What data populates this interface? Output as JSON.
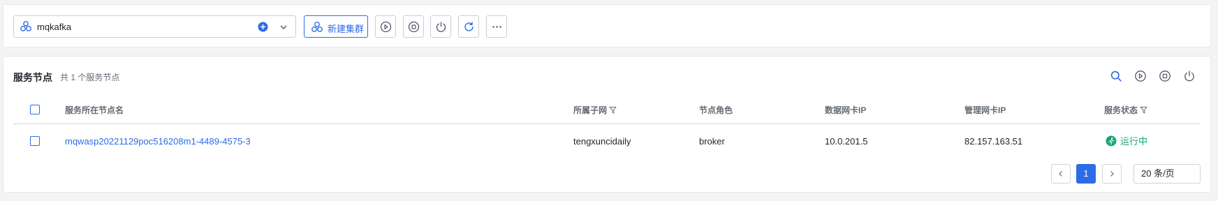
{
  "toolbar": {
    "cluster_select_value": "mqkafka",
    "new_cluster_label": "新建集群",
    "icons": [
      "cluster-icon",
      "add-circle-icon",
      "chevron-down-icon",
      "cluster-add-icon",
      "play-icon",
      "stop-icon",
      "power-icon",
      "refresh-icon",
      "more-icon"
    ]
  },
  "nodes": {
    "title": "服务节点",
    "count_text": "共 1 个服务节点",
    "tools": [
      "search-icon",
      "play-icon",
      "stop-icon",
      "power-icon"
    ],
    "columns": {
      "name": "服务所在节点名",
      "subnet": "所属子网",
      "role": "节点角色",
      "data_ip": "数据网卡IP",
      "mgmt_ip": "管理网卡IP",
      "status": "服务状态"
    },
    "rows": [
      {
        "name": "mqwasp20221129poc516208m1-4489-4575-3",
        "subnet": "tengxuncidaily",
        "role": "broker",
        "data_ip": "10.0.201.5",
        "mgmt_ip": "82.157.163.51",
        "status": "运行中"
      }
    ]
  },
  "pagination": {
    "current_page": "1",
    "page_size": "20 条/页"
  },
  "colors": {
    "primary": "#2e6be6",
    "running": "#14a870",
    "border": "#c9cdd4",
    "muted_text": "#646a73"
  }
}
